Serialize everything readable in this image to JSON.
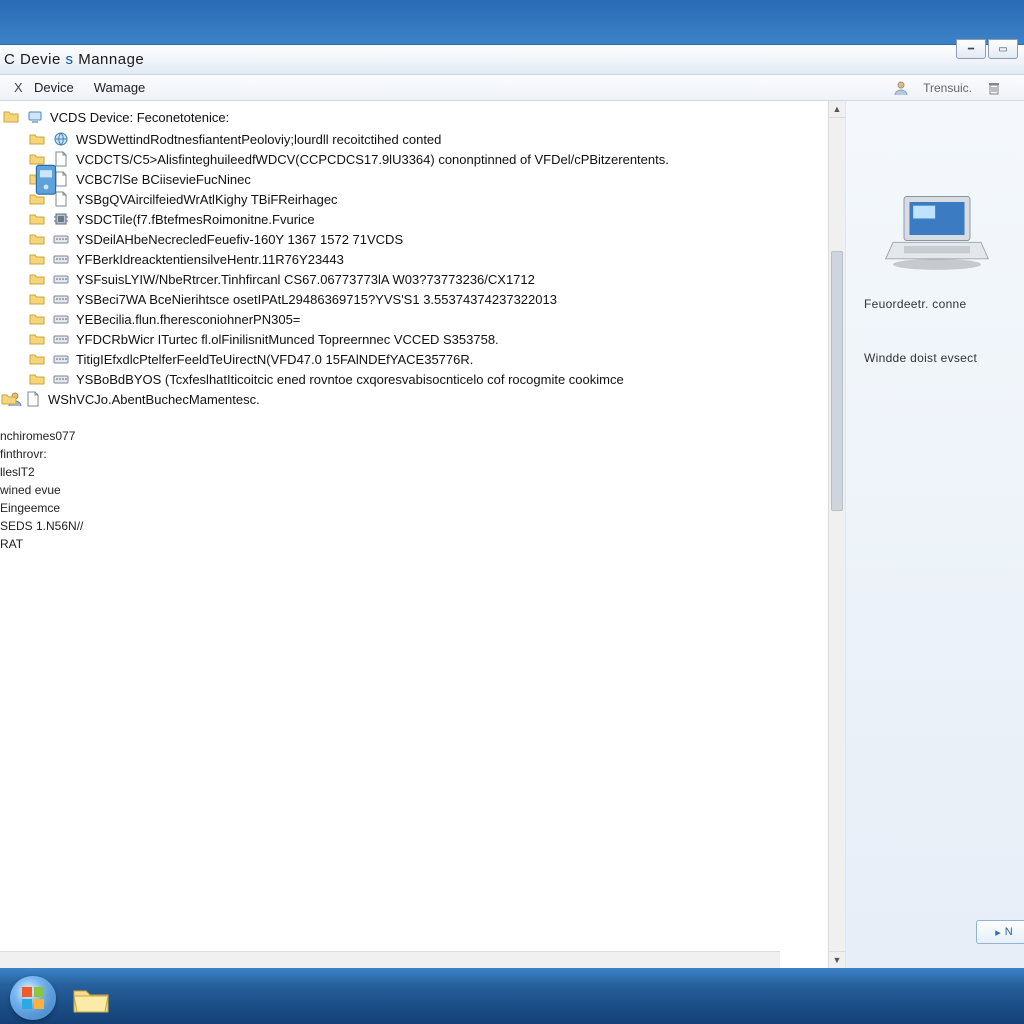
{
  "window": {
    "title_prefix": "C Devie ",
    "title_emph": "s",
    "title_suffix": " Mannage"
  },
  "menu": {
    "close": "X",
    "item1": "Device",
    "item2": "Wamage",
    "right_label": "Trensuic."
  },
  "tree": {
    "root_label": "VCDS   Device: Feconetotenice:",
    "items": [
      "WSDWettindRodtnesfiantentPeoloviy;lourdll recoitctihed conted",
      "VCDCTS/C5>AlisfinteghuileedfWDCV(CCPCDCS17.9lU3364) cononptinned of VFDel/cPBitzerentents.",
      "VCBC7lSe BCiisevieFucNinec",
      "YSBgQVAircilfeiedWrAtlKighy TBiFReirhagec",
      "YSDCTile(f7.fBtefmesRoimonitne.Fvurice",
      "YSDeilAHbeNecrecledFeuefiv-160Y 1367 1572 71VCDS",
      "YFBerkIdreacktentiensilveHentr.11R76Y23443",
      "YSFsuisLYIW/NbeRtrcer.Tinhfircanl CS67.06773773lA W03?73773236/CX1712",
      "YSBeci7WA BceNierihtsce osetIPAtL29486369715?YVS'S1 3.55374374237322013",
      "YEBecilia.flun.fheresconiohnerPN305=",
      "YFDCRbWicr ITurtec fl.olFinilisnitMunced Topreernnec  VCCED S353758.",
      "TitigIEfxdlcPtelferFeeldTeUirectN(VFD47.0 15FAlNDEfYACE35776R.",
      "YSBoBdBYOS (TcxfeslhatIticoitcic ened rovntoe cxqoresvabisocnticelo cof rocogmite cookimce",
      "WShVCJo.AbentBuchecMamentesc."
    ]
  },
  "side_lines": [
    "nchiromes077",
    "finthrovr:",
    "lleslT2",
    "wined evue",
    "Eingeemce",
    "SEDS 1.N56N//",
    "RAT"
  ],
  "right_panel": {
    "line1": "Feuordeetr. conne",
    "line2": "Windde doist evsect"
  },
  "ghost_button": "N"
}
